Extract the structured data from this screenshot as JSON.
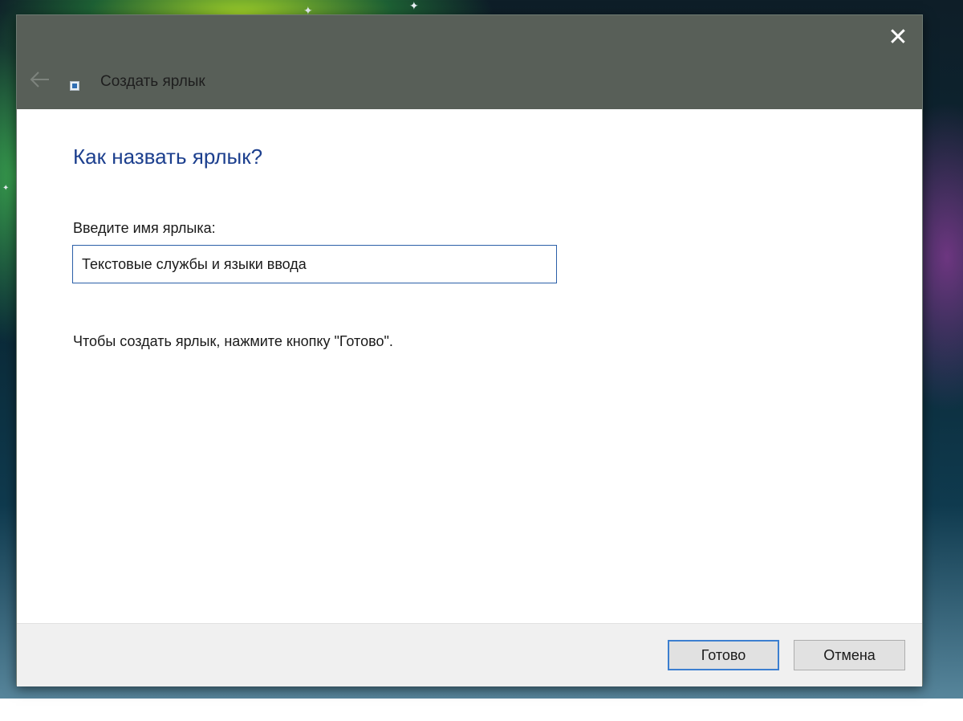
{
  "window": {
    "title": "Создать ярлык",
    "close_glyph": "✕",
    "icons": [
      "arrow-left-icon",
      "shortcut-app-icon",
      "close-icon"
    ]
  },
  "content": {
    "heading": "Как назвать ярлык?",
    "field_label": "Введите имя ярлыка:",
    "name_value": "Текстовые службы и языки ввода",
    "hint": "Чтобы создать ярлык, нажмите кнопку \"Готово\"."
  },
  "footer": {
    "finish_label": "Готово",
    "cancel_label": "Отмена"
  },
  "colors": {
    "titlebar": "#585f58",
    "heading": "#1c3f8e",
    "input_border": "#2b5fa8",
    "default_button_border": "#3c7fd0"
  }
}
